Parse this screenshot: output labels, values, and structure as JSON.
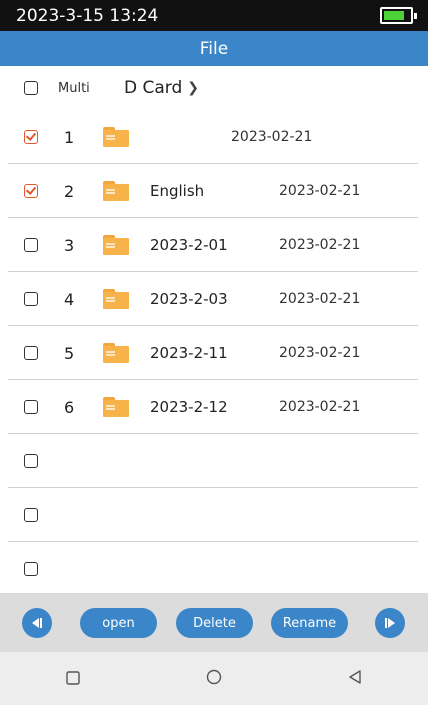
{
  "status": {
    "datetime": "2023-3-15 13:24",
    "battery_icon": "battery-icon",
    "battery_level_percent": 70
  },
  "title": "File",
  "header": {
    "multi_label": "Multi",
    "breadcrumb": "D Card",
    "breadcrumb_icon": "chevron-right-icon"
  },
  "rows": [
    {
      "checked": true,
      "num": "1",
      "name": "",
      "date": "2023-02-21"
    },
    {
      "checked": true,
      "num": "2",
      "name": "English",
      "date": "2023-02-21"
    },
    {
      "checked": false,
      "num": "3",
      "name": "2023-2-01",
      "date": "2023-02-21"
    },
    {
      "checked": false,
      "num": "4",
      "name": "2023-2-03",
      "date": "2023-02-21"
    },
    {
      "checked": false,
      "num": "5",
      "name": "2023-2-11",
      "date": "2023-02-21"
    },
    {
      "checked": false,
      "num": "6",
      "name": "2023-2-12",
      "date": "2023-02-21"
    },
    {
      "checked": false,
      "num": "",
      "name": "",
      "date": ""
    },
    {
      "checked": false,
      "num": "",
      "name": "",
      "date": ""
    },
    {
      "checked": false,
      "num": "",
      "name": "",
      "date": ""
    }
  ],
  "toolbar": {
    "prev_icon": "previous-page-icon",
    "open_label": "open",
    "delete_label": "Delete",
    "rename_label": "Rename",
    "next_icon": "next-page-icon"
  },
  "navbar": {
    "recent_icon": "square-icon",
    "home_icon": "circle-icon",
    "back_icon": "triangle-back-icon"
  },
  "colors": {
    "accent": "#3a86c8",
    "checked": "#e0572d",
    "folder": "#f7b24a",
    "battery": "#4cd137"
  }
}
